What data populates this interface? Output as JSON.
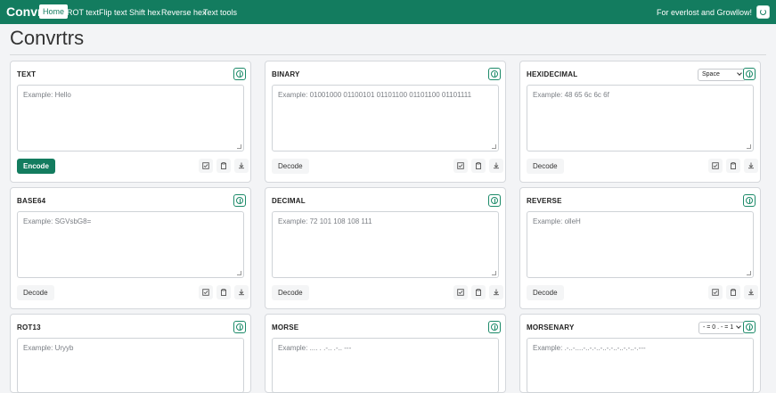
{
  "nav": {
    "brand": "Convrtr",
    "links": [
      "Home",
      "ROT text",
      "Flip text",
      "Shift hex",
      "Reverse hex",
      "Text tools"
    ],
    "tagline": "For everlost and Growllow!",
    "theme_icon": "theme-toggle-icon"
  },
  "page": {
    "title": "Convrtrs"
  },
  "cards": [
    {
      "title": "TEXT",
      "placeholder": "Example: Hello",
      "button": "Encode"
    },
    {
      "title": "BINARY",
      "placeholder": "Example: 01001000 01100101 01101100 01101100 01101111",
      "button": "Decode"
    },
    {
      "title": "HEXIDECIMAL",
      "placeholder": "Example: 48 65 6c 6c 6f",
      "button": "Decode",
      "select": "Space"
    },
    {
      "title": "BASE64",
      "placeholder": "Example: SGVsbG8=",
      "button": "Decode"
    },
    {
      "title": "DECIMAL",
      "placeholder": "Example: 72 101 108 108 111",
      "button": "Decode"
    },
    {
      "title": "REVERSE",
      "placeholder": "Example: olleH",
      "button": "Decode"
    },
    {
      "title": "ROT13",
      "placeholder": "Example: Uryyb"
    },
    {
      "title": "MORSE",
      "placeholder": "Example: .... . .-.. .-.. ---"
    },
    {
      "title": "MORSENARY",
      "placeholder": "Example: .-..-....-..-.-..-..-.-..-..-.-..-.---",
      "select": "- = 0 . - = 1"
    }
  ],
  "icons": {
    "info": "info-icon",
    "check": "check-icon",
    "clipboard": "clipboard-icon",
    "download": "download-icon"
  },
  "colors": {
    "primary": "#137c5f",
    "background": "#f3f4f6",
    "card": "#ffffff"
  }
}
